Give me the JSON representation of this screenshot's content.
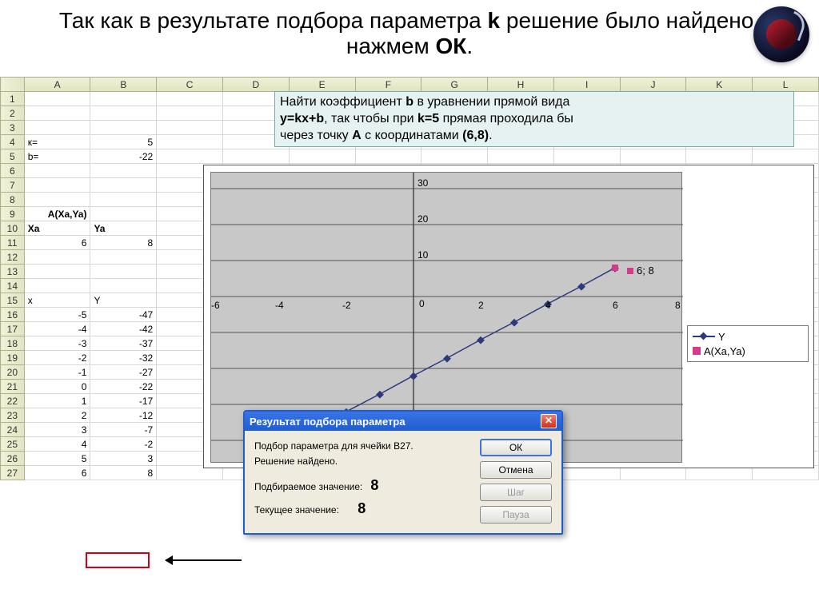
{
  "slide": {
    "title_pre": "Так как в результате подбора параметра ",
    "title_k": "k",
    "title_mid": " решение было найдено, нажмем ",
    "title_ok": "ОК",
    "title_post": "."
  },
  "columns": [
    "A",
    "B",
    "C",
    "D",
    "E",
    "F",
    "G",
    "H",
    "I",
    "J",
    "K",
    "L"
  ],
  "row_numbers": [
    "1",
    "2",
    "3",
    "4",
    "5",
    "6",
    "7",
    "8",
    "9",
    "10",
    "11",
    "12",
    "13",
    "14",
    "15",
    "16",
    "17",
    "18",
    "19",
    "20",
    "21",
    "22",
    "23",
    "24",
    "25",
    "26",
    "27"
  ],
  "cells": {
    "A4": "к=",
    "B4": "5",
    "A5": "b=",
    "B5": "-22",
    "A9": "A(Xa,Ya)",
    "A10": "Xa",
    "B10": "Ya",
    "A11": "6",
    "B11": "8",
    "A15": "x",
    "B15": "Y",
    "A16": "-5",
    "B16": "-47",
    "A17": "-4",
    "B17": "-42",
    "A18": "-3",
    "B18": "-37",
    "A19": "-2",
    "B19": "-32",
    "A20": "-1",
    "B20": "-27",
    "A21": "0",
    "B21": "-22",
    "A22": "1",
    "B22": "-17",
    "A23": "2",
    "B23": "-12",
    "A24": "3",
    "B24": "-7",
    "A25": "4",
    "B25": "-2",
    "A26": "5",
    "B26": "3",
    "A27": "6",
    "B27": "8"
  },
  "task": {
    "line1a": "Найти коэффициент ",
    "line1b": "b",
    "line1c": " в уравнении прямой вида",
    "line2a": "у=kх+b",
    "line2b": ", так чтобы при ",
    "line2c": "k=5",
    "line2d": " прямая проходила бы",
    "line3a": "через точку ",
    "line3b": "А",
    "line3c": " с координатами ",
    "line3d": "(6,8)",
    "line3e": "."
  },
  "chart": {
    "legend_y": "Y",
    "legend_a": "A(Xa,Ya)",
    "point_label": "6; 8",
    "x_ticks": [
      "-6",
      "-4",
      "-2",
      "0",
      "2",
      "4",
      "6",
      "8"
    ],
    "y_ticks": [
      "30",
      "20",
      "10",
      "0"
    ]
  },
  "chart_data": {
    "type": "line",
    "series": [
      {
        "name": "Y",
        "x": [
          -5,
          -4,
          -3,
          -2,
          -1,
          0,
          1,
          2,
          3,
          4,
          5,
          6
        ],
        "y": [
          -47,
          -42,
          -37,
          -32,
          -27,
          -22,
          -17,
          -12,
          -7,
          -2,
          3,
          8
        ]
      },
      {
        "name": "A(Xa,Ya)",
        "x": [
          6
        ],
        "y": [
          8
        ]
      }
    ],
    "xlim": [
      -6,
      8
    ],
    "ylim": [
      -50,
      30
    ],
    "xlabel": "",
    "ylabel": "",
    "title": ""
  },
  "dialog": {
    "title": "Результат подбора параметра",
    "line1": "Подбор параметра для ячейки B27.",
    "line2": "Решение найдено.",
    "label_target": "Подбираемое значение:",
    "label_current": "Текущее значение:",
    "val_target": "8",
    "val_current": "8",
    "btn_ok": "ОК",
    "btn_cancel": "Отмена",
    "btn_step": "Шаг",
    "btn_pause": "Пауза",
    "close": "✕"
  }
}
